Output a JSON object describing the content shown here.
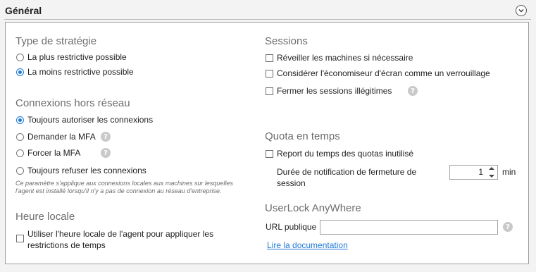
{
  "header": {
    "title": "Général"
  },
  "strategy": {
    "title": "Type de stratégie",
    "options": [
      {
        "label": "La plus restrictive possible",
        "checked": false
      },
      {
        "label": "La moins restrictive possible",
        "checked": true
      }
    ]
  },
  "offline": {
    "title": "Connexions hors réseau",
    "options": [
      {
        "label": "Toujours autoriser les connexions",
        "checked": true,
        "help": false
      },
      {
        "label": "Demander la MFA",
        "checked": false,
        "help": true
      },
      {
        "label": "Forcer la MFA",
        "checked": false,
        "help": true
      },
      {
        "label": "Toujours refuser les connexions",
        "checked": false,
        "help": false
      }
    ],
    "note": "Ce paramètre s'applique aux connexions locales aux machines sur lesquelles l'agent est installé lorsqu'il n'y a pas de connexion au réseau d'entreprise."
  },
  "localtime": {
    "title": "Heure locale",
    "checkbox_label_line1": "Utiliser l'heure locale de l'agent pour appliquer les",
    "checkbox_label_line2": "restrictions de temps",
    "checked": false
  },
  "sessions": {
    "title": "Sessions",
    "options": [
      {
        "label": "Réveiller les machines si nécessaire",
        "checked": false
      },
      {
        "label": "Considérer l'économiseur d'écran comme un verrouillage",
        "checked": false
      },
      {
        "label": "Fermer les sessions illégitimes",
        "checked": false
      }
    ]
  },
  "quota": {
    "title": "Quota en temps",
    "checkbox_label": "Report du temps des quotas inutilisé",
    "checked": false,
    "duration_label_line1": "Durée de notification de fermeture de",
    "duration_label_line2": "session",
    "duration_value": "1",
    "duration_unit": "min"
  },
  "anywhere": {
    "title": "UserLock AnyWhere",
    "url_label": "URL publique",
    "url_value": "",
    "doc_link": "Lire la documentation"
  },
  "icons": {
    "help": "help-icon",
    "toggle": "chevron-down-icon"
  },
  "colors": {
    "accent": "#1f7ad6",
    "section_title": "#6d6d6d",
    "help_icon": "#c9c9c9"
  }
}
